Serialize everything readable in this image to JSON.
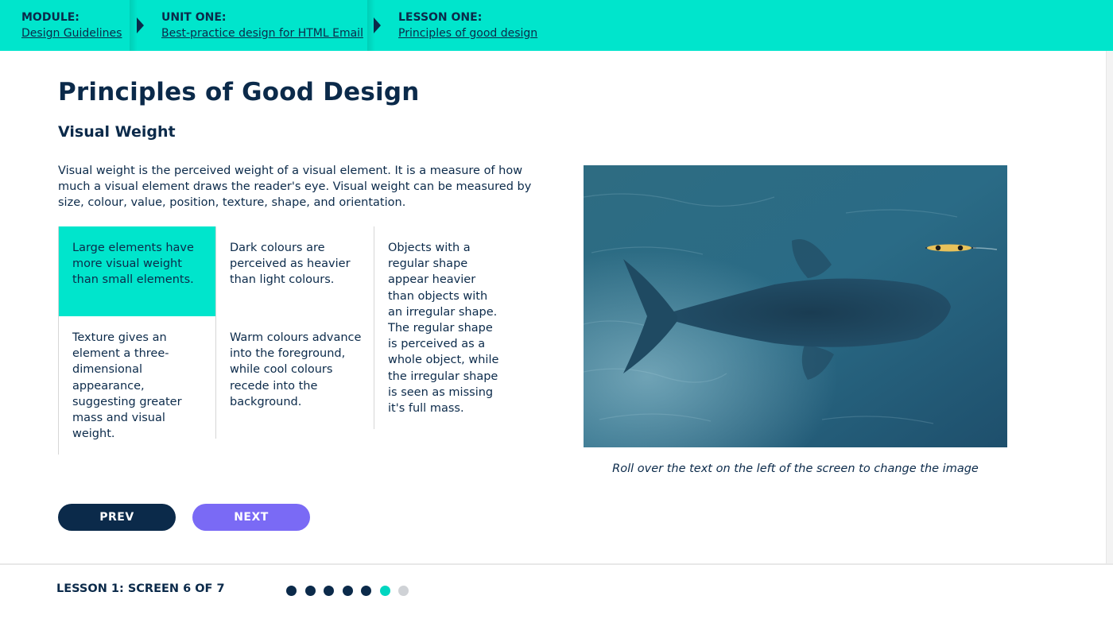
{
  "breadcrumb": [
    {
      "title": "MODULE:",
      "link": "Design Guidelines"
    },
    {
      "title": "UNIT ONE:",
      "link": "Best-practice design for HTML Email"
    },
    {
      "title": "LESSON ONE:",
      "link": "Principles of good design"
    }
  ],
  "page": {
    "title": "Principles of Good Design",
    "subtitle": "Visual Weight",
    "intro": "Visual weight is the perceived weight of a visual element. It is a measure of how much a visual element draws the reader's eye. Visual weight can be measured by size, colour, value, position, texture, shape, and orientation."
  },
  "grid": {
    "large_elements": "Large elements have more visual weight than small elements.",
    "dark_colours": "Dark colours are perceived as heavier than light colours.",
    "regular_shape": "Objects with a regular shape appear heavier than objects with an irregular shape. The regular shape is perceived as a whole object, while the irregular shape is seen as missing it's full mass.",
    "texture": "Texture gives an element a three-dimensional appearance, suggesting greater mass and visual weight.",
    "warm_colours": "Warm colours advance into the foreground, while cool colours recede into the background."
  },
  "image": {
    "caption": "Roll over the text on the left of the screen to change the image"
  },
  "nav": {
    "prev_label": "PREV",
    "next_label": "NEXT"
  },
  "footer": {
    "progress_label": "LESSON 1: SCREEN 6 OF 7",
    "total_screens": 7,
    "current_screen": 6
  },
  "colors": {
    "accent_teal": "#00e5cc",
    "navy": "#0b2a4a",
    "next_button": "#7a6af5",
    "dot_inactive": "#cfd2d6"
  },
  "icons": [
    "breadcrumb-arrow-icon",
    "progress-dot-icon"
  ]
}
